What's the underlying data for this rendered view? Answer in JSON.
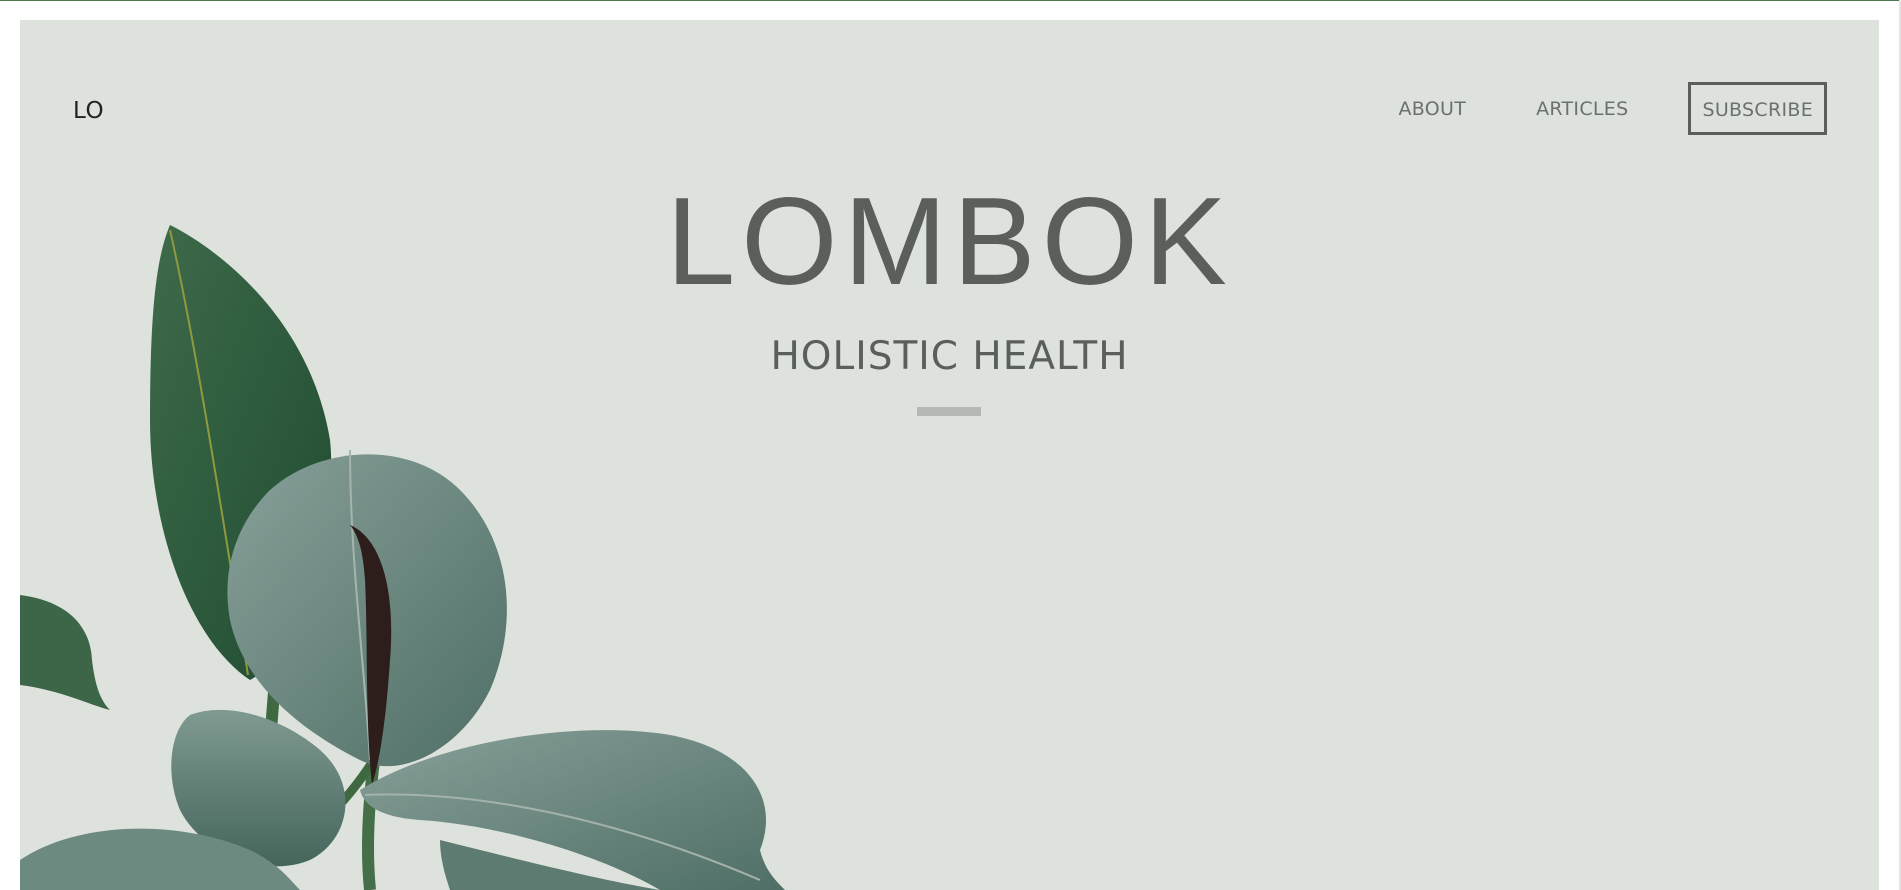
{
  "header": {
    "logo": "LO",
    "nav": {
      "about": "ABOUT",
      "articles": "ARTICLES",
      "subscribe": "SUBSCRIBE"
    }
  },
  "hero": {
    "title": "LOMBOK",
    "subtitle": "HOLISTIC HEALTH",
    "background_color": "#dde2dd",
    "text_color": "#5a5f59",
    "image": "rubber-plant-leaves"
  }
}
